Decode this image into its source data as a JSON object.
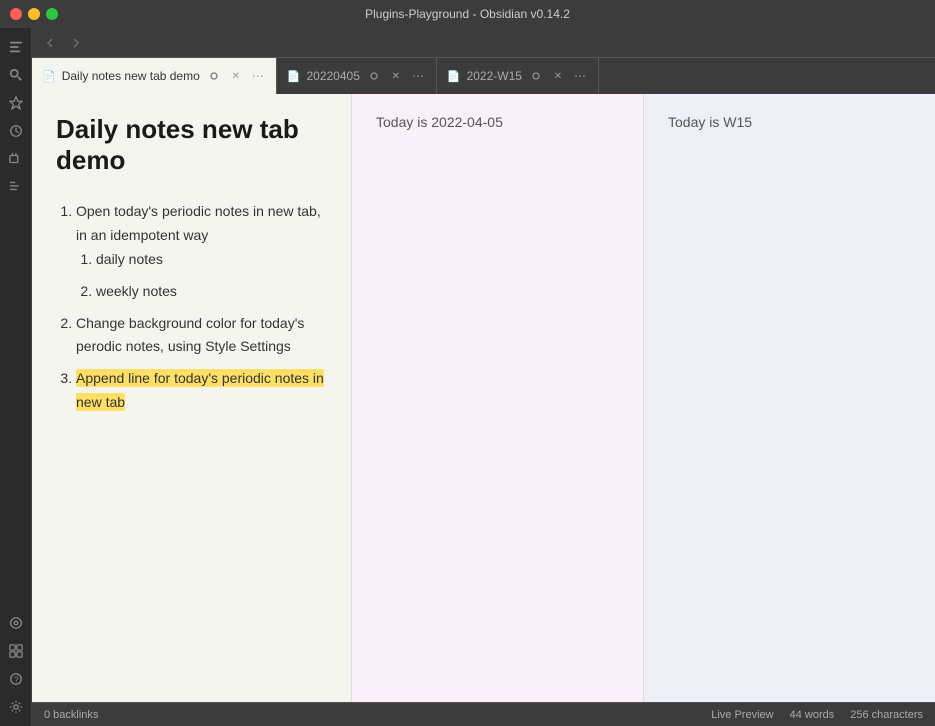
{
  "window": {
    "title": "Plugins-Playground - Obsidian v0.14.2"
  },
  "traffic_lights": {
    "close": "close",
    "minimize": "minimize",
    "maximize": "maximize"
  },
  "sidebar": {
    "icons": [
      {
        "name": "file-tree-icon",
        "glyph": "⊞"
      },
      {
        "name": "search-icon",
        "glyph": "🔍"
      },
      {
        "name": "starred-icon",
        "glyph": "☆"
      },
      {
        "name": "recent-icon",
        "glyph": "↻"
      },
      {
        "name": "tags-icon",
        "glyph": "⌗"
      },
      {
        "name": "outline-icon",
        "glyph": "≡"
      }
    ],
    "bottom_icons": [
      {
        "name": "graph-icon",
        "glyph": "◎"
      },
      {
        "name": "command-icon",
        "glyph": "⌘"
      },
      {
        "name": "plugin-icon",
        "glyph": "⚙"
      },
      {
        "name": "help-icon",
        "glyph": "?"
      },
      {
        "name": "settings-icon",
        "glyph": "⚙"
      }
    ]
  },
  "tabs": [
    {
      "id": "tab-main",
      "label": "Daily notes new tab demo",
      "icon": "📄",
      "active": true
    },
    {
      "id": "tab-daily",
      "label": "20220405",
      "icon": "📄",
      "active": false
    },
    {
      "id": "tab-weekly",
      "label": "2022-W15",
      "icon": "📄",
      "active": false
    }
  ],
  "panels": {
    "left": {
      "title": "Daily notes new tab\ndemo",
      "content_items": [
        {
          "type": "ordered",
          "text": "Open today's periodic notes in new tab, in an idempotent way",
          "sub_items": [
            "daily notes",
            "weekly notes"
          ]
        },
        {
          "type": "ordered",
          "text": "Change background color for today's perodic notes, using Style Settings"
        },
        {
          "type": "ordered",
          "text_normal": "",
          "text_highlighted": "Append line for today's periodic notes in new tab",
          "highlighted": true
        }
      ]
    },
    "center": {
      "text": "Today is 2022-04-05"
    },
    "right": {
      "text": "Today is W15"
    }
  },
  "status_bar": {
    "backlinks": "0 backlinks",
    "live_preview": "Live Preview",
    "words": "44 words",
    "characters": "256 characters"
  }
}
